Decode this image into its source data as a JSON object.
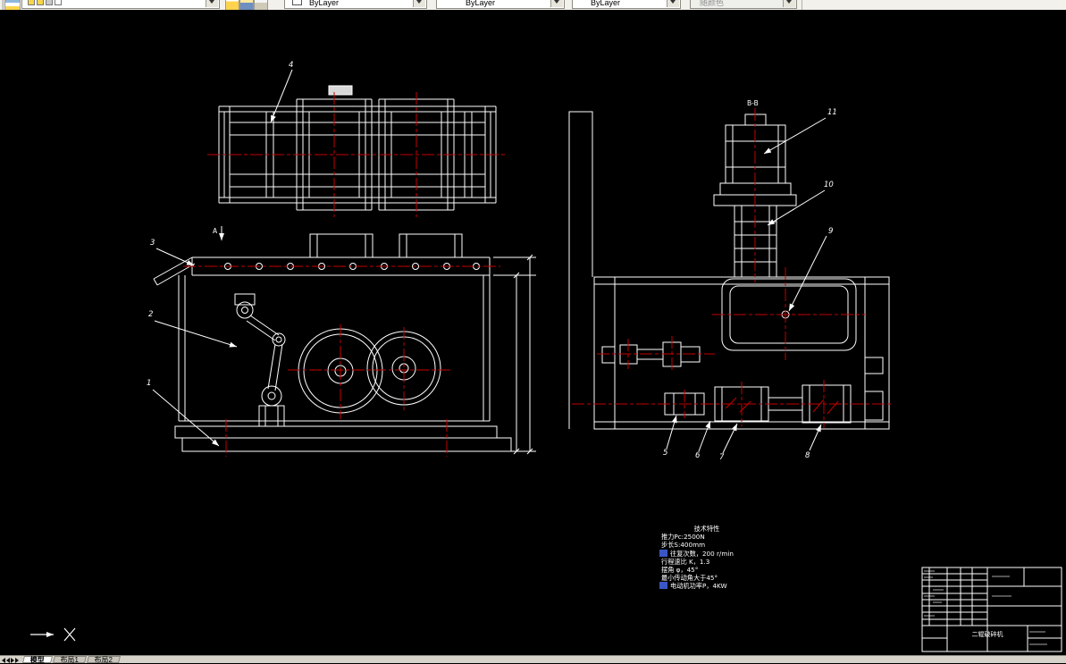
{
  "toolbar": {
    "color_dropdown": {
      "value": "ByLayer"
    },
    "linetype_dropdown": {
      "value": "ByLayer"
    },
    "lineweight_dropdown": {
      "value": "ByLayer"
    },
    "plotstyle_dropdown": {
      "value": "随颜色"
    }
  },
  "tabs": {
    "model": "模型",
    "layout1": "布局1",
    "layout2": "布局2"
  },
  "drawing": {
    "section_label": "B-B",
    "view_arrow_label": "A",
    "callouts": {
      "n1": "1",
      "n2": "2",
      "n3": "3",
      "n4": "4",
      "n5": "5",
      "n6": "6",
      "n7": "7",
      "n8": "8",
      "n9": "9",
      "n10": "10",
      "n11": "11"
    },
    "tech_notes": {
      "title": "技术特性",
      "lines": [
        "推力Pc:2500N",
        "步长S:400mm",
        "往复次数，200 r/min",
        "行程速比 K，1.3",
        "摆角 φ，45°",
        "最小传动角大于45°",
        "电动机功率P，4KW"
      ]
    },
    "title_block": {
      "product_name": "二辊破碎机"
    }
  },
  "colors": {
    "canvas_bg": "#000000",
    "geometry": "#ffffff",
    "centerline": "#c40000",
    "field_highlight": "#3a56c4"
  }
}
